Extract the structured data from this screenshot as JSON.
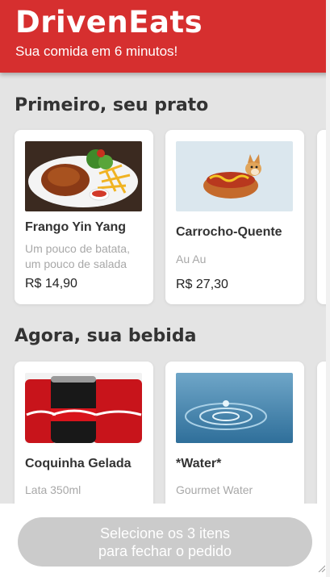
{
  "header": {
    "title": "DrivenEats",
    "subtitle": "Sua comida em 6 minutos!"
  },
  "sections": [
    {
      "title": "Primeiro, seu prato",
      "items": [
        {
          "name": "Frango Yin Yang",
          "desc": "Um pouco de batata, um pouco de salada",
          "price": "R$ 14,90"
        },
        {
          "name": "Carrocho-Quente",
          "desc": "Au Au",
          "price": "R$ 27,30"
        }
      ]
    },
    {
      "title": "Agora, sua bebida",
      "items": [
        {
          "name": "Coquinha Gelada",
          "desc": "Lata 350ml",
          "price": ""
        },
        {
          "name": "*Water*",
          "desc": "Gourmet Water",
          "price": ""
        }
      ]
    }
  ],
  "footer": {
    "button_line1": "Selecione os 3 itens",
    "button_line2": "para fechar o pedido"
  },
  "colors": {
    "brand": "#d62f2f",
    "button_disabled": "#cbcbcb",
    "background": "#e4e4e4"
  }
}
